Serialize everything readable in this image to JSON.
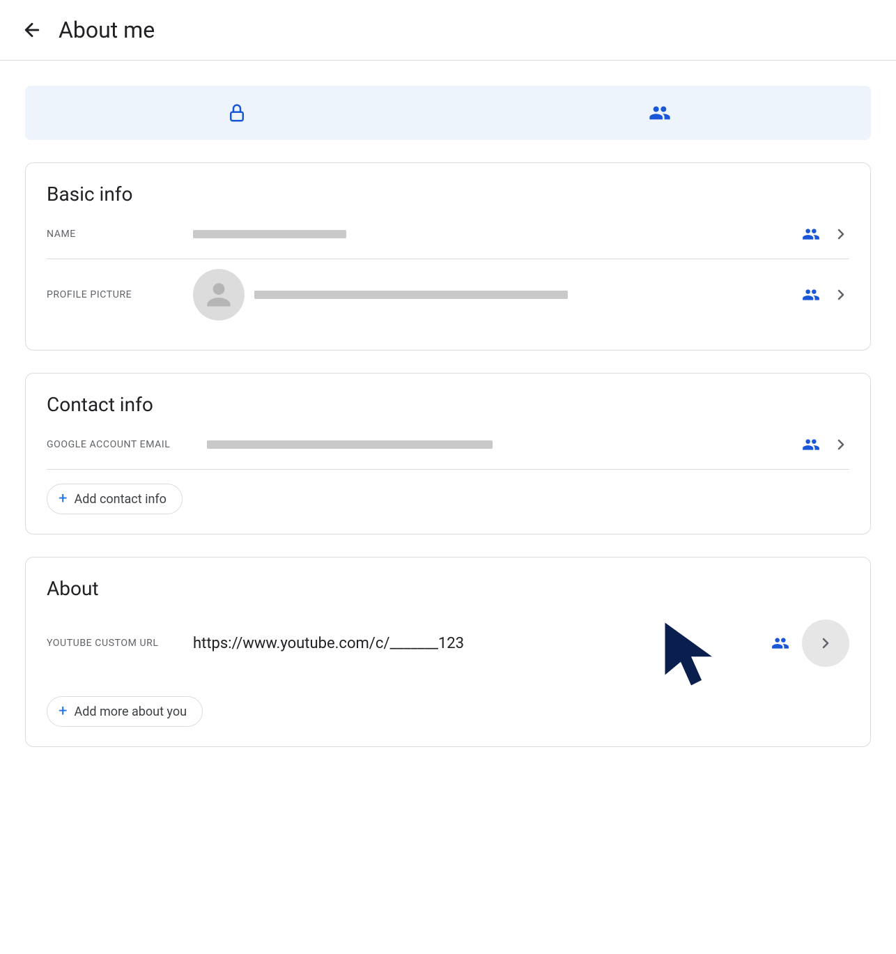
{
  "header": {
    "title": "About me"
  },
  "sections": {
    "basic": {
      "title": "Basic info",
      "name_label": "NAME",
      "picture_label": "PROFILE PICTURE"
    },
    "contact": {
      "title": "Contact info",
      "email_label": "GOOGLE ACCOUNT EMAIL",
      "add_button": "Add contact info"
    },
    "about": {
      "title": "About",
      "youtube_label": "YOUTUBE CUSTOM URL",
      "youtube_value": "https://www.youtube.com/c/_______123",
      "add_button": "Add more about you"
    }
  }
}
